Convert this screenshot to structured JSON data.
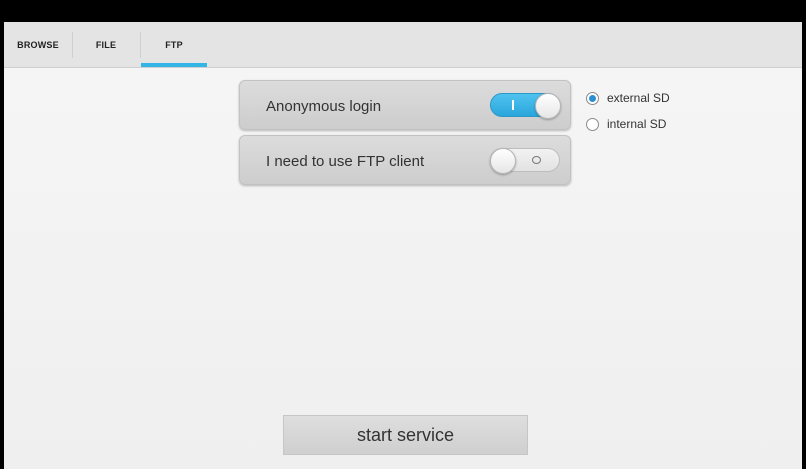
{
  "tabs": [
    {
      "label": "BROWSE",
      "selected": false
    },
    {
      "label": "FILE",
      "selected": false
    },
    {
      "label": "FTP",
      "selected": true
    }
  ],
  "accent_color": "#33b5e5",
  "settings": {
    "anonymous_login": {
      "label": "Anonymous login",
      "enabled": true
    },
    "ftp_client": {
      "label": "I need to use FTP client",
      "enabled": false
    }
  },
  "storage": {
    "options": [
      {
        "label": "external SD",
        "checked": true
      },
      {
        "label": "internal SD",
        "checked": false
      }
    ]
  },
  "start_button_label": "start service"
}
